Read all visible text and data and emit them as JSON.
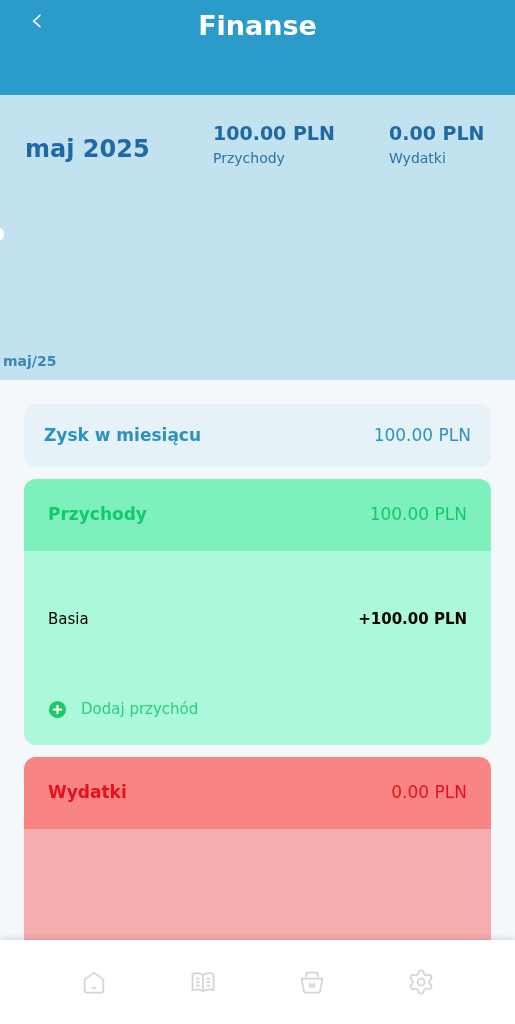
{
  "header": {
    "back": "‹",
    "title": "Finanse"
  },
  "summary": {
    "month": "maj 2025",
    "stats": [
      {
        "amount": "100.00 PLN",
        "label": "Przychody"
      },
      {
        "amount": "0.00 PLN",
        "label": "Wydatki"
      }
    ],
    "chart_label": "maj/25"
  },
  "profit": {
    "label": "Zysk w miesiącu",
    "amount": "100.00 PLN"
  },
  "sections": [
    {
      "kind": "income",
      "title": "Przychody",
      "total": "100.00 PLN",
      "entries": [
        {
          "name": "Basia",
          "amount": "+100.00 PLN"
        }
      ],
      "add": "Dodaj przychód"
    },
    {
      "kind": "expense",
      "title": "Wydatki",
      "total": "0.00 PLN"
    }
  ],
  "nav": [
    {
      "kind": "home"
    },
    {
      "kind": "book"
    },
    {
      "kind": "basket"
    },
    {
      "kind": "settings"
    }
  ]
}
